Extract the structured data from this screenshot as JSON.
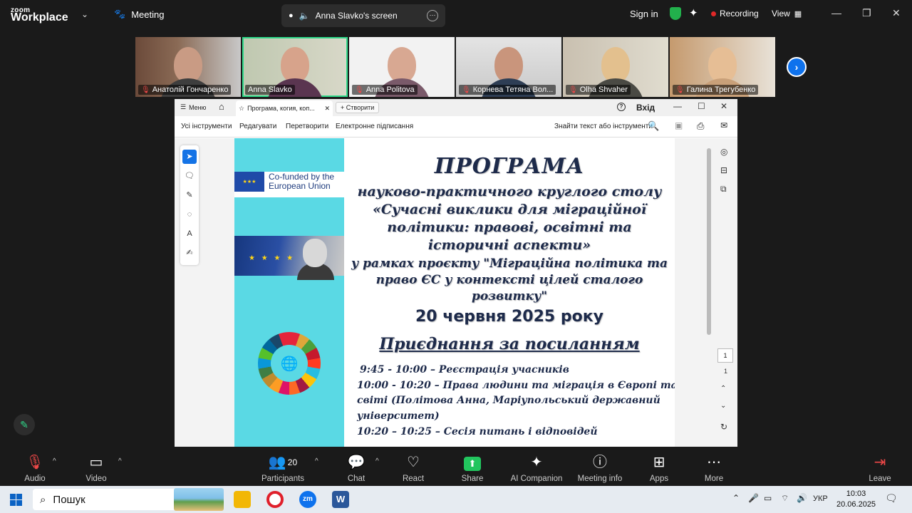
{
  "topbar": {
    "logo_small": "zoom",
    "logo_big": "Workplace",
    "meeting_tab": "Meeting",
    "share_tab": "Anna Slavko's screen",
    "sign_in": "Sign in",
    "recording": "Recording",
    "view": "View"
  },
  "participants_strip": [
    {
      "name": "Анатолій Гончаренко",
      "muted": true
    },
    {
      "name": "Anna Slavko",
      "muted": false,
      "active": true
    },
    {
      "name": "Anna Politova",
      "muted": true
    },
    {
      "name": "Корнева Тетяна Вол...",
      "muted": true
    },
    {
      "name": "Olha Shvaher",
      "muted": true
    },
    {
      "name": "Галина Трегубенко",
      "muted": true
    }
  ],
  "pdf_window": {
    "menu": "Меню",
    "tab_title": "Програма, когия, коп...",
    "new_tab": "Створити",
    "login": "Вхід",
    "toolbar": {
      "all_tools": "Усі інструменти",
      "edit": "Редагувати",
      "convert": "Перетворити",
      "esign": "Електронне підписання",
      "find": "Знайти текст або інструменти"
    },
    "page_number": "1",
    "page_total": "1",
    "page": {
      "eu_text_line1": "Co-funded by the",
      "eu_text_line2": "European Union",
      "title": "ПРОГРАМА",
      "sub_lines": [
        "науково-практичного круглого столу",
        "«Сучасні виклики для міграційної",
        "політики: правові, освітні та",
        "історичні аспекти»",
        "у рамках проєкту \"Міграційна політика та",
        "право ЄС у контексті цілей сталого",
        "розвитку\""
      ],
      "date": "20 червня 2025 року",
      "link": "Приєднання за посиланням",
      "agenda": [
        "9:45 - 10:00 – Реєстрація учасників",
        "10:00 - 10:20 – Права людини та міграція в Європі та",
        "світі (Політова Анна, Маріупольський державний",
        "університет)",
        "10:20 – 10:25 – Сесія питань і відповідей"
      ]
    }
  },
  "toolbar": {
    "audio": "Audio",
    "video": "Video",
    "participants": "Participants",
    "participants_count": "20",
    "chat": "Chat",
    "react": "React",
    "share": "Share",
    "ai_companion": "AI Companion",
    "meeting_info": "Meeting info",
    "apps": "Apps",
    "more": "More",
    "leave": "Leave"
  },
  "taskbar": {
    "search_placeholder": "Пошук",
    "language": "УКР",
    "time": "10:03",
    "date": "20.06.2025"
  },
  "colors": {
    "zoom_bg": "#1a1a1a",
    "zoom_blue": "#0e72ed",
    "share_green": "#22c55e",
    "pdf_cyan": "#5ad9e4",
    "active_speaker": "#2fd98a"
  }
}
